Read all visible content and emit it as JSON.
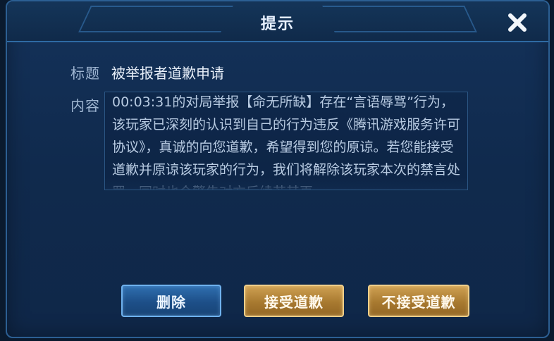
{
  "dialog": {
    "title": "提示",
    "title_label": "标题",
    "title_value": "被举报者道歉申请",
    "content_label": "内容",
    "content_text": "00:03:31的对局举报【命无所缺】存在“言语辱骂”行为，该玩家已深刻的认识到自己的行为违反《腾讯游戏服务许可协议》，真诚的向您道歉，希望得到您的原谅。若您能接受道歉并原谅该玩家的行为，我们将解除该玩家本次的禁言处罚，同时也会警告对方后续若其再"
  },
  "buttons": {
    "delete": "删除",
    "accept": "接受道歉",
    "reject": "不接受道歉"
  },
  "icons": {
    "close": "close-icon"
  }
}
